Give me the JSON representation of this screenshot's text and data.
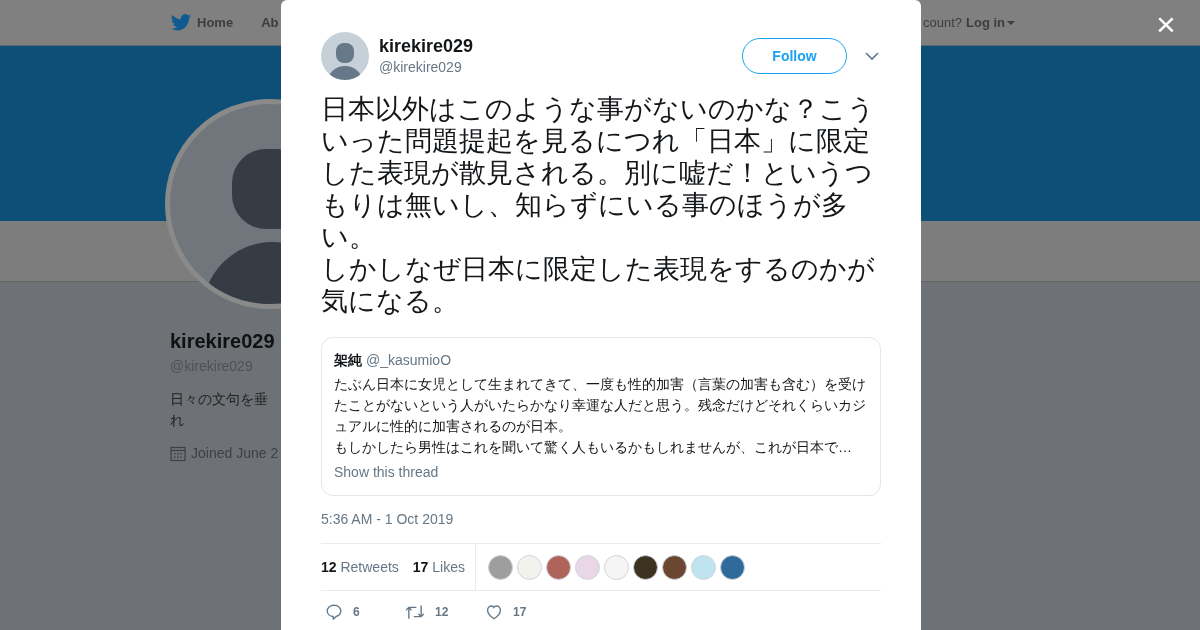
{
  "background_page": {
    "nav": {
      "home": "Home",
      "about": "Ab",
      "account_prompt": "count?",
      "login": "Log in"
    },
    "profile": {
      "name": "kirekire029",
      "handle": "@kirekire029",
      "bio": "日々の文句を垂れ",
      "joined": "Joined June 2"
    }
  },
  "close_button": "×",
  "tweet": {
    "author": {
      "name": "kirekire029",
      "handle": "@kirekire029"
    },
    "follow_button": "Follow",
    "text": [
      "日本以外はこのような事がないのかな？こういった問題提起を見るにつれ「日本」に限定した表現が散見される。別に嘘だ！というつもりは無いし、知らずにいる事のほうが多い。",
      "しかしなぜ日本に限定した表現をするのかが気になる。"
    ],
    "quoted": {
      "name": "架純",
      "handle": "@_kasumioO",
      "text": [
        "たぶん日本に女児として生まれてきて、一度も性的加害（言葉の加害も含む）を受けたことがないという人がいたらかなり幸運な人だと思う。残念だけどそれくらいカジュアルに性的に加害されるのが日本。",
        "もしかしたら男性はこれを聞いて驚く人もいるかもしれませんが、これが日本で…"
      ],
      "link": "Show this thread"
    },
    "timestamp": "5:36 AM - 1 Oct 2019",
    "stats": [
      {
        "count": "12",
        "label": "Retweets"
      },
      {
        "count": "17",
        "label": "Likes"
      }
    ],
    "liked_by": [
      {
        "color": "#9e9e9e"
      },
      {
        "color": "#f2f2ee"
      },
      {
        "color": "#b0635a"
      },
      {
        "color": "#e9d6e6"
      },
      {
        "color": "#f5f5f5"
      },
      {
        "color": "#3b3320"
      },
      {
        "color": "#6b4630"
      },
      {
        "color": "#bfe3ef"
      },
      {
        "color": "#2f6a9a"
      }
    ],
    "actions": [
      {
        "kind": "reply",
        "count": "6"
      },
      {
        "kind": "retweet",
        "count": "12"
      },
      {
        "kind": "like",
        "count": "17"
      }
    ]
  }
}
